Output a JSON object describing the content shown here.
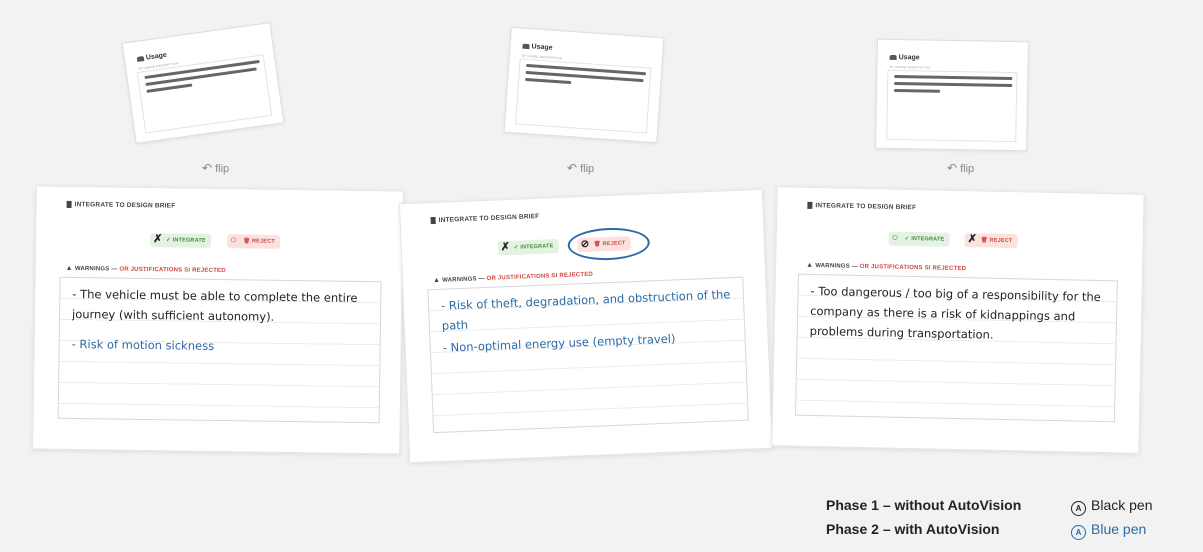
{
  "usage_card": {
    "title": "Usage",
    "subtitle": "SF USAGE DESCRIPTION"
  },
  "flip_label": "flip",
  "card": {
    "header": "INTEGRATE TO DESIGN BRIEF",
    "integrate_label": "✓ INTEGRATE",
    "reject_label": "🗑 REJECT",
    "warnings_prefix": "WARNINGS — ",
    "warnings_suffix": "OR JUSTIFICATIONS SI REJECTED"
  },
  "cards": [
    {
      "decision": "integrate",
      "notes": [
        {
          "color": "black",
          "text": "- The vehicle must be able to complete the entire journey (with sufficient autonomy)."
        },
        {
          "color": "blue",
          "text": "- Risk of motion sickness"
        }
      ]
    },
    {
      "decision": "reject",
      "notes": [
        {
          "color": "blue",
          "text": "- Risk of theft, degradation, and obstruction of the path"
        },
        {
          "color": "blue",
          "text": "- Non-optimal energy use (empty travel)"
        }
      ]
    },
    {
      "decision": "reject",
      "notes": [
        {
          "color": "black",
          "text": "- Too dangerous / too big of a responsibility for the company as there is a risk of kidnappings and problems during transportation."
        }
      ]
    }
  ],
  "legend": {
    "phase1": "Phase 1 – without AutoVision",
    "phase2": "Phase 2 – with AutoVision",
    "pen1": "Black pen",
    "pen2": "Blue pen",
    "pen1_color": "#222222",
    "pen2_color": "#2b6aa8"
  }
}
